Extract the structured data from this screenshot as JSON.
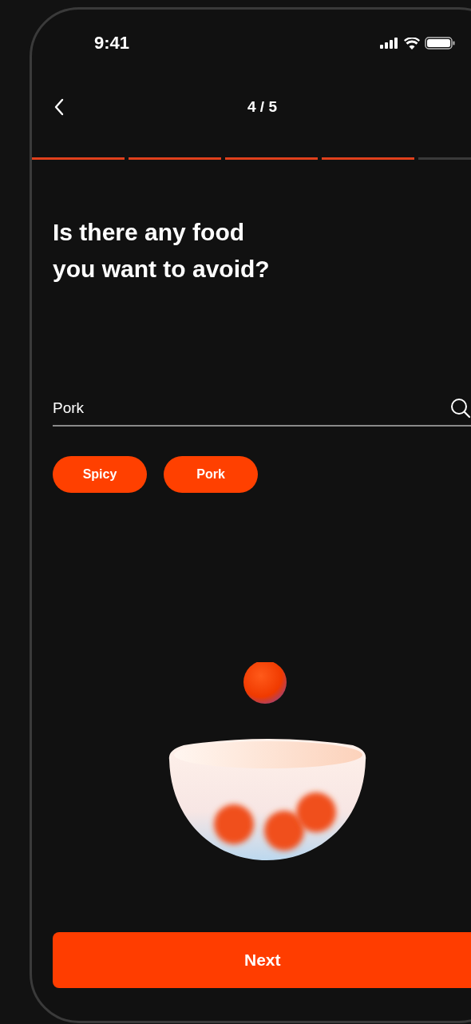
{
  "status_bar": {
    "time": "9:41"
  },
  "header": {
    "step": "4 / 5"
  },
  "progress": [
    {
      "done": true
    },
    {
      "done": true
    },
    {
      "done": true
    },
    {
      "done": true
    },
    {
      "done": false
    }
  ],
  "question": "Is there any food you want to avoid?",
  "search": {
    "value": "Pork"
  },
  "chips": [
    {
      "label": "Spicy",
      "selected": true
    },
    {
      "label": "Pork",
      "selected": true
    }
  ],
  "next_button": "Next"
}
